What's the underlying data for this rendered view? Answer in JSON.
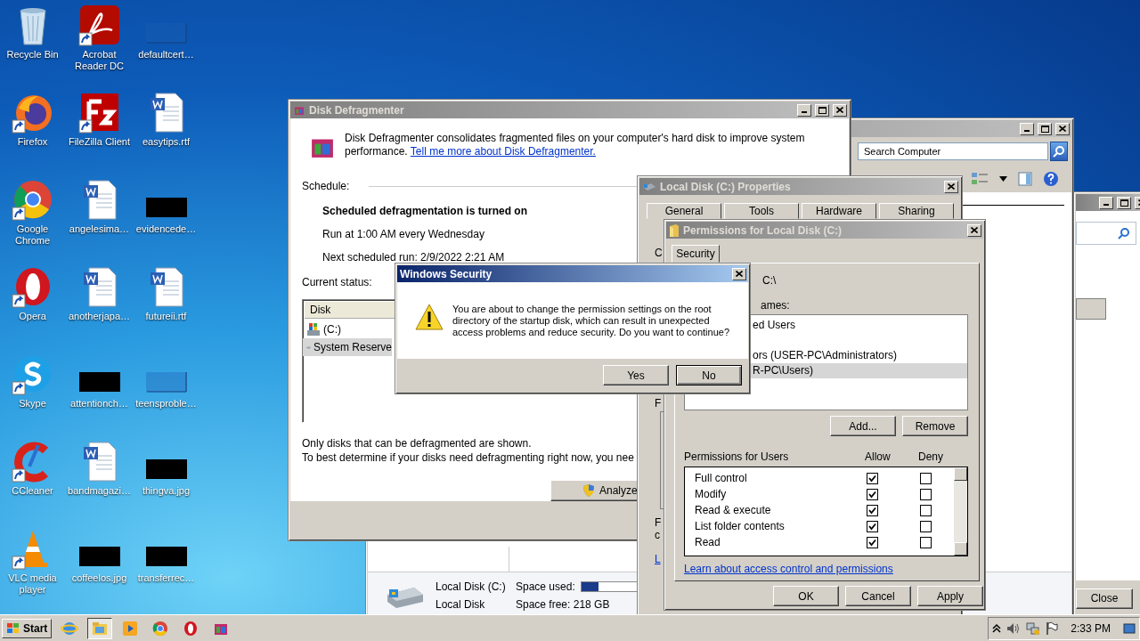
{
  "desktop_icons": [
    {
      "label": "Recycle Bin",
      "kind": "recycle",
      "shortcut": false
    },
    {
      "label": "Firefox",
      "kind": "firefox",
      "shortcut": true
    },
    {
      "label": "Google Chrome",
      "kind": "chrome",
      "shortcut": true
    },
    {
      "label": "Opera",
      "kind": "opera",
      "shortcut": true
    },
    {
      "label": "Skype",
      "kind": "skype",
      "shortcut": true
    },
    {
      "label": "CCleaner",
      "kind": "ccleaner",
      "shortcut": true
    },
    {
      "label": "VLC media player",
      "kind": "vlc",
      "shortcut": true
    },
    {
      "label": "Acrobat Reader DC",
      "kind": "acrobat",
      "shortcut": true
    },
    {
      "label": "FileZilla Client",
      "kind": "filezilla",
      "shortcut": true
    },
    {
      "label": "angelesima…",
      "kind": "word",
      "shortcut": false
    },
    {
      "label": "anotherjapa…",
      "kind": "word",
      "shortcut": false
    },
    {
      "label": "attentionch…",
      "kind": "redacted",
      "shortcut": false
    },
    {
      "label": "bandmagazi…",
      "kind": "word",
      "shortcut": false
    },
    {
      "label": "coffeelos.jpg",
      "kind": "redacted",
      "shortcut": false
    },
    {
      "label": "defaultcert…",
      "kind": "thumb",
      "shortcut": false
    },
    {
      "label": "easytips.rtf",
      "kind": "word",
      "shortcut": false
    },
    {
      "label": "evidencede…",
      "kind": "redacted",
      "shortcut": false
    },
    {
      "label": "futureii.rtf",
      "kind": "word",
      "shortcut": false
    },
    {
      "label": "teensproble…",
      "kind": "thumb",
      "shortcut": false
    },
    {
      "label": "thingva.jpg",
      "kind": "redacted",
      "shortcut": false
    },
    {
      "label": "transferrec…",
      "kind": "redacted",
      "shortcut": false
    }
  ],
  "right_window": {
    "close_button": "Close"
  },
  "explorer": {
    "search": {
      "placeholder": "Search Computer"
    },
    "details": {
      "name": "Local Disk (C:)",
      "type": "Local Disk",
      "used_label": "Space used:",
      "level": 0.13,
      "free": "Space free: 218 GB"
    }
  },
  "defragmenter": {
    "title": "Disk Defragmenter",
    "intro": "Disk Defragmenter consolidates fragmented files on your computer's hard disk to improve system performance.",
    "intro_link": "Tell me more about Disk Defragmenter.",
    "schedule_label": "Schedule:",
    "schedule_status": "Scheduled defragmentation is turned on",
    "schedule_run": "Run at 1:00 AM every Wednesday",
    "schedule_next": "Next scheduled run: 2/9/2022 2:21 AM",
    "status_label": "Current status:",
    "column": "Disk",
    "disks": [
      {
        "name": "(C:)",
        "kind": "system",
        "selected": false
      },
      {
        "name": "System Reserve",
        "kind": "drive",
        "selected": true
      }
    ],
    "note_1": "Only disks that can be defragmented are shown.",
    "note_2": "To best determine if your disks need defragmenting right now, you nee",
    "analyze": "Analyze"
  },
  "properties": {
    "title": "Local Disk (C:) Properties",
    "tabs": [
      {
        "label": "General",
        "selected": false
      },
      {
        "label": "Tools",
        "selected": false
      },
      {
        "label": "Hardware",
        "selected": false
      },
      {
        "label": "Sharing",
        "selected": false
      }
    ],
    "fragments": [
      {
        "text": "C",
        "kind": "label"
      },
      {
        "text": "F",
        "kind": "label"
      },
      {
        "text": "F",
        "kind": "label"
      },
      {
        "text": "c",
        "kind": "label"
      },
      {
        "text": "L",
        "kind": "link"
      }
    ]
  },
  "permissions": {
    "title": "Permissions for Local Disk (C:)",
    "tab": "Security",
    "object": "C:\\",
    "groups_label": "ames:",
    "groups": [
      {
        "name": "ed Users",
        "selected": false
      },
      {
        "name": "ors (USER-PC\\Administrators)",
        "selected": false
      },
      {
        "name": "R-PC\\Users)",
        "selected": true
      }
    ],
    "add": "Add...",
    "remove": "Remove",
    "perm_label": "Permissions for Users",
    "allow": "Allow",
    "deny": "Deny",
    "rows": [
      {
        "name": "Full control",
        "allow": true,
        "deny": false
      },
      {
        "name": "Modify",
        "allow": true,
        "deny": false
      },
      {
        "name": "Read & execute",
        "allow": true,
        "deny": false
      },
      {
        "name": "List folder contents",
        "allow": true,
        "deny": false
      },
      {
        "name": "Read",
        "allow": true,
        "deny": false
      }
    ],
    "link": "Learn about access control and permissions",
    "buttons": [
      "OK",
      "Cancel",
      "Apply"
    ]
  },
  "security_dialog": {
    "title": "Windows Security",
    "message": "You are about to change the permission settings on the root directory of the startup disk, which can result in unexpected access problems and reduce security. Do you want to continue?",
    "buttons": [
      {
        "label": "Yes",
        "selected": false
      },
      {
        "label": "No",
        "selected": true
      }
    ]
  },
  "taskbar": {
    "start": "Start",
    "apps": [
      {
        "kind": "ie",
        "selected": false
      },
      {
        "kind": "explorer",
        "selected": true
      },
      {
        "kind": "media",
        "selected": false
      },
      {
        "kind": "chrome",
        "selected": false
      },
      {
        "kind": "opera",
        "selected": false
      },
      {
        "kind": "defrag",
        "selected": false
      }
    ],
    "time": "2:33 PM"
  }
}
